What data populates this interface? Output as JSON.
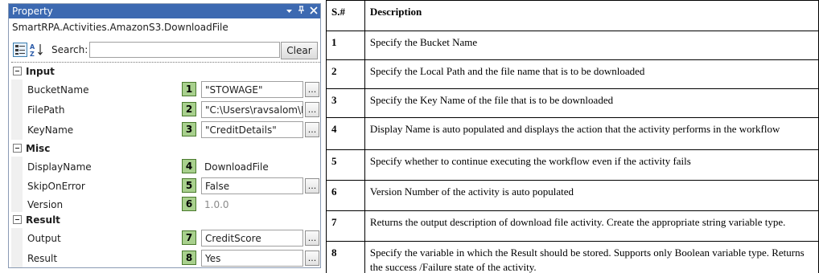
{
  "panel": {
    "title": "Property",
    "title_icons": [
      "dropdown-arrow-icon",
      "pin-icon",
      "close-icon"
    ],
    "class_name": "SmartRPA.Activities.AmazonS3.DownloadFile",
    "search_label": "Search:",
    "search_value": "",
    "clear_label": "Clear",
    "categories": [
      {
        "label": "Input",
        "properties": [
          {
            "name": "BucketName",
            "badge": "1",
            "value": "\"STOWAGE\"",
            "style": "box",
            "has_button": true
          },
          {
            "name": "FilePath",
            "badge": "2",
            "value": "\"C:\\Users\\ravsalom\\De",
            "style": "box",
            "has_button": true
          },
          {
            "name": "KeyName",
            "badge": "3",
            "value": "\"CreditDetails\"",
            "style": "box",
            "has_button": true
          }
        ]
      },
      {
        "label": "Misc",
        "properties": [
          {
            "name": "DisplayName",
            "badge": "4",
            "value": "DownloadFile",
            "style": "plain",
            "has_button": false
          },
          {
            "name": "SkipOnError",
            "badge": "5",
            "value": "False",
            "style": "box",
            "has_button": true
          },
          {
            "name": "Version",
            "badge": "6",
            "value": "1.0.0",
            "style": "gray",
            "has_button": false
          }
        ]
      },
      {
        "label": "Result",
        "properties": [
          {
            "name": "Output",
            "badge": "7",
            "value": "CreditScore",
            "style": "box",
            "has_button": true
          },
          {
            "name": "Result",
            "badge": "8",
            "value": "Yes",
            "style": "box",
            "has_button": true
          }
        ]
      }
    ],
    "button_label": "..."
  },
  "table": {
    "headers": [
      "S.#",
      "Description"
    ],
    "rows": [
      {
        "num": "1",
        "desc": "Specify the Bucket Name"
      },
      {
        "num": "2",
        "desc": "Specify the Local Path and the file name that is to be downloaded"
      },
      {
        "num": "3",
        "desc": "Specify the Key Name of the file that is to be downloaded"
      },
      {
        "num": "4",
        "desc": "Display Name is auto populated and displays the action that the activity performs in the workflow"
      },
      {
        "num": "5",
        "desc": "Specify whether to continue executing the workflow even if the activity fails"
      },
      {
        "num": "6",
        "desc": "Version Number of the activity is auto populated"
      },
      {
        "num": "7",
        "desc": "Returns the output description of download file activity. Create the appropriate string variable type."
      },
      {
        "num": "8",
        "desc": "Specify the variable in which the Result should be stored. Supports only Boolean variable type. Returns the success /Failure state of the activity."
      }
    ]
  },
  "colors": {
    "titlebar": "#3c69b1",
    "badge_fill": "#a8d08d",
    "badge_border": "#4a7a2e"
  }
}
